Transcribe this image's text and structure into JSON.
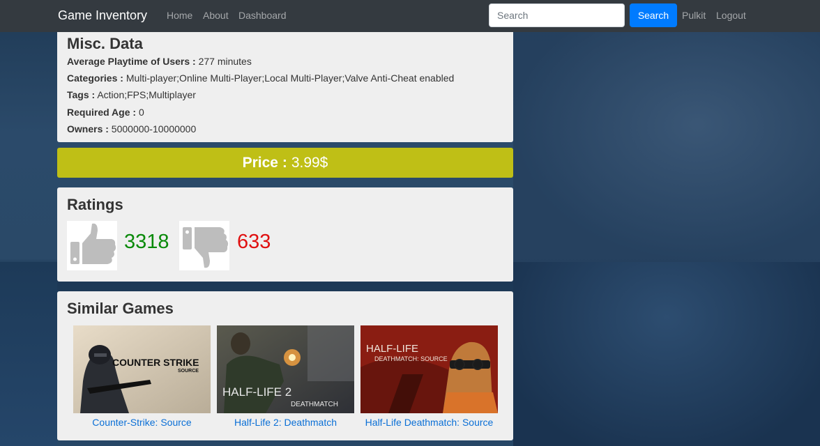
{
  "navbar": {
    "brand": "Game Inventory",
    "links": [
      "Home",
      "About",
      "Dashboard"
    ],
    "search_placeholder": "Search",
    "search_button": "Search",
    "user": "Pulkit",
    "logout": "Logout"
  },
  "misc": {
    "title": "Misc. Data",
    "rows": [
      {
        "label": "Average Playtime of Users :",
        "value": "277 minutes"
      },
      {
        "label": "Categories :",
        "value": "Multi-player;Online Multi-Player;Local Multi-Player;Valve Anti-Cheat enabled"
      },
      {
        "label": "Tags :",
        "value": "Action;FPS;Multiplayer"
      },
      {
        "label": "Required Age :",
        "value": "0"
      },
      {
        "label": "Owners :",
        "value": "5000000-10000000"
      }
    ]
  },
  "price": {
    "label": "Price :",
    "value": "3.99$"
  },
  "ratings": {
    "title": "Ratings",
    "positive": "3318",
    "negative": "633"
  },
  "similar": {
    "title": "Similar Games",
    "games": [
      {
        "title": "Counter-Strike: Source",
        "art_text": "COUNTER STRIKE",
        "art_sub": "SOURCE"
      },
      {
        "title": "Half-Life 2: Deathmatch",
        "art_text": "HALF-LIFE 2",
        "art_sub": "DEATHMATCH"
      },
      {
        "title": "Half-Life Deathmatch: Source",
        "art_text": "HALF-LIFE",
        "art_sub": "DEATHMATCH: SOURCE"
      }
    ]
  },
  "colors": {
    "navbar": "#343a40",
    "accent": "#007bff",
    "price_bar": "#bfbf16",
    "positive": "#0a8a0a",
    "negative": "#e01010",
    "link": "#0a6fd6"
  }
}
